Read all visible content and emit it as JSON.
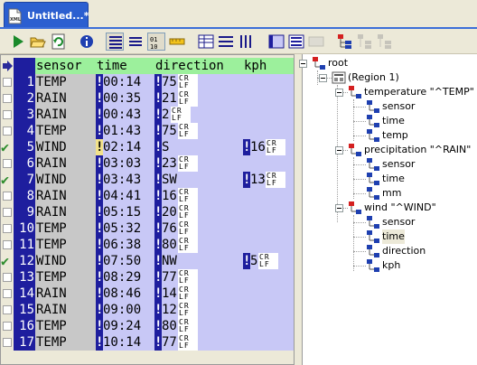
{
  "tab": {
    "title": "Untitled...*",
    "icon": "xml-document-icon"
  },
  "toolbar": {
    "buttons": [
      {
        "name": "run-button",
        "icon": "play-icon"
      },
      {
        "name": "open-button",
        "icon": "folder-open-icon"
      },
      {
        "name": "refresh-button",
        "icon": "refresh-icon"
      },
      {
        "name": "info-button",
        "icon": "info-icon"
      },
      {
        "name": "view-list-button",
        "icon": "list-icon"
      },
      {
        "name": "view-lines-button",
        "icon": "lines-icon"
      },
      {
        "name": "binary-view-button",
        "icon": "binary-icon"
      },
      {
        "name": "ruler-button",
        "icon": "ruler-icon"
      },
      {
        "name": "table-view-button",
        "icon": "table-icon"
      },
      {
        "name": "rows-view-button",
        "icon": "rows-icon"
      },
      {
        "name": "columns-view-button",
        "icon": "columns-icon"
      },
      {
        "name": "grid-icon-button",
        "icon": "grid-icon"
      },
      {
        "name": "form-view-button",
        "icon": "form-icon"
      },
      {
        "name": "disabled-view-button",
        "icon": "disabled-grid-icon"
      },
      {
        "name": "tree-red-button",
        "icon": "tree-red-icon"
      },
      {
        "name": "tree-up-button",
        "icon": "tree-up-icon"
      },
      {
        "name": "tree-down-button",
        "icon": "tree-down-icon"
      }
    ]
  },
  "grid": {
    "columns": [
      "sensor",
      "time",
      "direction",
      "kph"
    ],
    "eol_glyph": [
      "CR",
      "LF"
    ],
    "rows": [
      {
        "num": "1",
        "sensor": "TEMP",
        "time": "00:14",
        "value": "75",
        "checked": false,
        "kph": ""
      },
      {
        "num": "2",
        "sensor": "RAIN",
        "time": "00:35",
        "value": "21",
        "checked": false,
        "kph": ""
      },
      {
        "num": "3",
        "sensor": "RAIN",
        "time": "00:43",
        "value": "2",
        "checked": false,
        "kph": ""
      },
      {
        "num": "4",
        "sensor": "TEMP",
        "time": "01:43",
        "value": "75",
        "checked": false,
        "kph": ""
      },
      {
        "num": "5",
        "sensor": "WIND",
        "time": "02:14",
        "value": "S",
        "checked": true,
        "kph": "16",
        "time_sep_yellow": true
      },
      {
        "num": "6",
        "sensor": "RAIN",
        "time": "03:03",
        "value": "23",
        "checked": false,
        "kph": ""
      },
      {
        "num": "7",
        "sensor": "WIND",
        "time": "03:43",
        "value": "SW",
        "checked": true,
        "kph": "13"
      },
      {
        "num": "8",
        "sensor": "RAIN",
        "time": "04:41",
        "value": "16",
        "checked": false,
        "kph": ""
      },
      {
        "num": "9",
        "sensor": "RAIN",
        "time": "05:15",
        "value": "20",
        "checked": false,
        "kph": ""
      },
      {
        "num": "10",
        "sensor": "TEMP",
        "time": "05:32",
        "value": "76",
        "checked": false,
        "kph": ""
      },
      {
        "num": "11",
        "sensor": "TEMP",
        "time": "06:38",
        "value": "80",
        "checked": false,
        "kph": ""
      },
      {
        "num": "12",
        "sensor": "WIND",
        "time": "07:50",
        "value": "NW",
        "checked": true,
        "kph": "5"
      },
      {
        "num": "13",
        "sensor": "TEMP",
        "time": "08:29",
        "value": "77",
        "checked": false,
        "kph": ""
      },
      {
        "num": "14",
        "sensor": "RAIN",
        "time": "08:46",
        "value": "14",
        "checked": false,
        "kph": ""
      },
      {
        "num": "15",
        "sensor": "RAIN",
        "time": "09:00",
        "value": "12",
        "checked": false,
        "kph": ""
      },
      {
        "num": "16",
        "sensor": "TEMP",
        "time": "09:24",
        "value": "80",
        "checked": false,
        "kph": ""
      },
      {
        "num": "17",
        "sensor": "TEMP",
        "time": "10:14",
        "value": "77",
        "checked": false,
        "kph": ""
      }
    ]
  },
  "tree": {
    "nodes": [
      {
        "label": "root",
        "level": 0,
        "kind": "root"
      },
      {
        "label": "(Region 1)",
        "level": 1,
        "kind": "region"
      },
      {
        "label": "temperature \"^TEMP\"",
        "level": 2,
        "kind": "record"
      },
      {
        "label": "sensor",
        "level": 3,
        "kind": "field"
      },
      {
        "label": "time",
        "level": 3,
        "kind": "field"
      },
      {
        "label": "temp",
        "level": 3,
        "kind": "field"
      },
      {
        "label": "precipitation \"^RAIN\"",
        "level": 2,
        "kind": "record"
      },
      {
        "label": "sensor",
        "level": 3,
        "kind": "field"
      },
      {
        "label": "time",
        "level": 3,
        "kind": "field"
      },
      {
        "label": "mm",
        "level": 3,
        "kind": "field"
      },
      {
        "label": "wind \"^WIND\"",
        "level": 2,
        "kind": "record"
      },
      {
        "label": "sensor",
        "level": 3,
        "kind": "field"
      },
      {
        "label": "time",
        "level": 3,
        "kind": "field",
        "selected": true
      },
      {
        "label": "direction",
        "level": 3,
        "kind": "field"
      },
      {
        "label": "kph",
        "level": 3,
        "kind": "field"
      }
    ]
  }
}
